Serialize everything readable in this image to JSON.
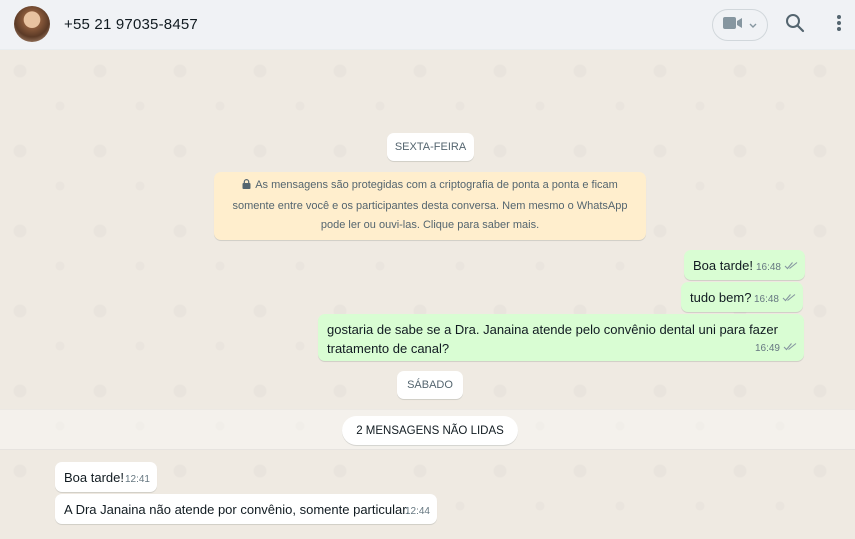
{
  "header": {
    "contact_name": "+55 21 97035-8457",
    "icons": [
      "video-call-icon",
      "chevron-down-icon",
      "search-icon",
      "menu-dots-icon"
    ]
  },
  "chat": {
    "date_friday": "SEXTA-FEIRA",
    "encryption_notice": "As mensagens são protegidas com a criptografia de ponta a ponta e ficam somente entre você e os participantes desta conversa. Nem mesmo o WhatsApp pode ler ou ouvi-las. Clique para saber mais.",
    "outgoing": [
      {
        "text": "Boa tarde!",
        "time": "16:48"
      },
      {
        "text": "tudo bem?",
        "time": "16:48"
      },
      {
        "text_line1": "gostaria de sabe se a Dra. Janaina atende pelo convênio dental uni para fazer",
        "text_line2": "tratamento de canal?",
        "time": "16:49"
      }
    ],
    "date_saturday": "SÁBADO",
    "unread_label": "2 MENSAGENS NÃO LIDAS",
    "incoming": [
      {
        "text": "Boa tarde!",
        "time": "12:41"
      },
      {
        "text": "A Dra Janaina não atende por convênio, somente particular.",
        "time": "12:44"
      }
    ]
  },
  "colors": {
    "header_bg": "#f0f2f5",
    "chat_bg": "#efeae2",
    "outgoing_bubble": "#d9fdd3",
    "incoming_bubble": "#ffffff",
    "notice_bg": "#ffeecd",
    "read_ticks": "#8696a0"
  }
}
